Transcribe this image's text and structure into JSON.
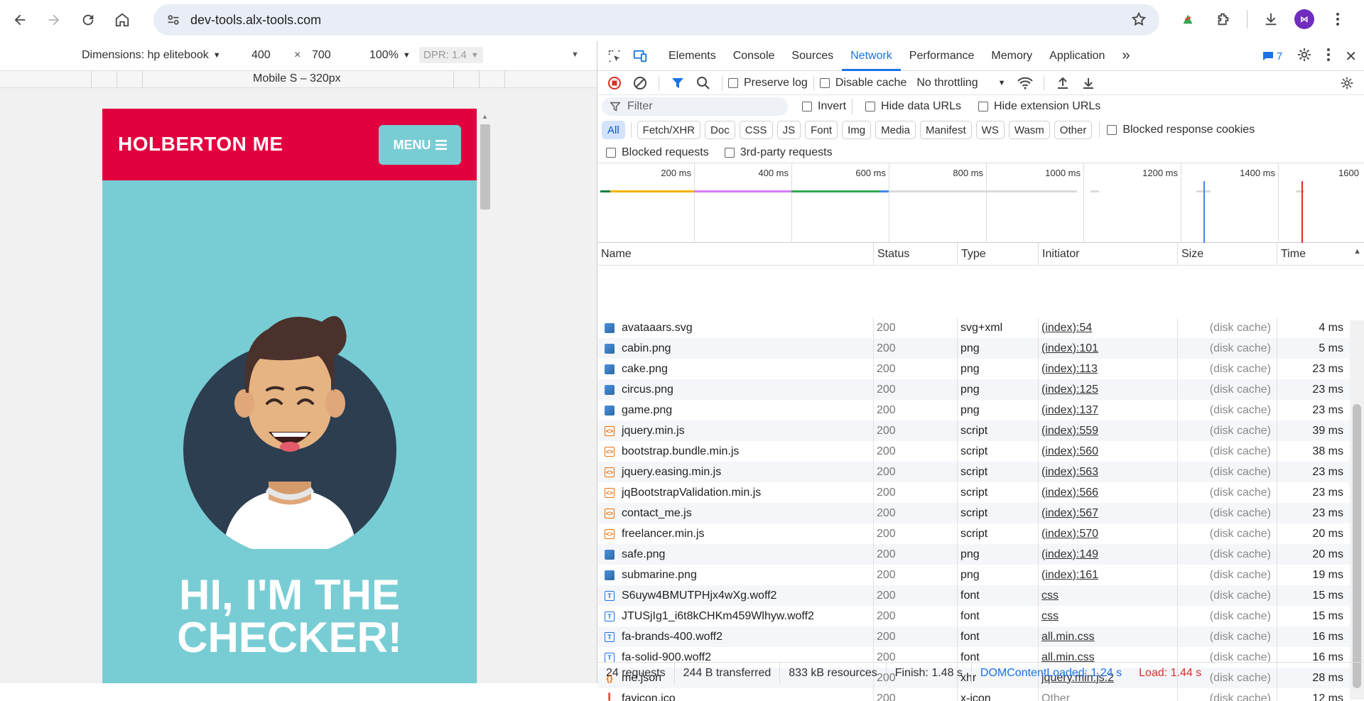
{
  "browser": {
    "url": "dev-tools.alx-tools.com",
    "back_icon": "arrow-left",
    "forward_icon": "arrow-right",
    "reload_icon": "reload",
    "home_icon": "home"
  },
  "device_toolbar": {
    "dimensions_label": "Dimensions: hp elitebook",
    "width": "400",
    "times": "×",
    "height": "700",
    "zoom": "100%",
    "dpr": "DPR: 1.4",
    "media_query_label": "Mobile S – 320px"
  },
  "site": {
    "brand": "HOLBERTON ME",
    "menu_label": "MENU",
    "hero_line1": "HI, I'M THE",
    "hero_line2": "CHECKER!"
  },
  "devtools": {
    "tabs": [
      "Elements",
      "Console",
      "Sources",
      "Network",
      "Performance",
      "Memory",
      "Application"
    ],
    "active_tab": "Network",
    "issues_count": "7",
    "toolbar": {
      "preserve_log": "Preserve log",
      "disable_cache": "Disable cache",
      "throttling": "No throttling"
    },
    "filter": {
      "placeholder": "Filter",
      "invert": "Invert",
      "hide_data_urls": "Hide data URLs",
      "hide_extension_urls": "Hide extension URLs"
    },
    "type_filters": [
      "All",
      "Fetch/XHR",
      "Doc",
      "CSS",
      "JS",
      "Font",
      "Img",
      "Media",
      "Manifest",
      "WS",
      "Wasm",
      "Other"
    ],
    "blocked_response_cookies": "Blocked response cookies",
    "blocked_requests": "Blocked requests",
    "third_party_requests": "3rd-party requests",
    "overview_ticks": [
      "200 ms",
      "400 ms",
      "600 ms",
      "800 ms",
      "1000 ms",
      "1200 ms",
      "1400 ms",
      "1600"
    ],
    "columns": [
      "Name",
      "Status",
      "Type",
      "Initiator",
      "Size",
      "Time"
    ],
    "requests": [
      {
        "icon": "img",
        "name": "avataaars.svg",
        "status": "200",
        "type": "svg+xml",
        "initiator": "(index):54",
        "size": "(disk cache)",
        "time": "4 ms"
      },
      {
        "icon": "img",
        "name": "cabin.png",
        "status": "200",
        "type": "png",
        "initiator": "(index):101",
        "size": "(disk cache)",
        "time": "5 ms"
      },
      {
        "icon": "img",
        "name": "cake.png",
        "status": "200",
        "type": "png",
        "initiator": "(index):113",
        "size": "(disk cache)",
        "time": "23 ms"
      },
      {
        "icon": "img",
        "name": "circus.png",
        "status": "200",
        "type": "png",
        "initiator": "(index):125",
        "size": "(disk cache)",
        "time": "23 ms"
      },
      {
        "icon": "img",
        "name": "game.png",
        "status": "200",
        "type": "png",
        "initiator": "(index):137",
        "size": "(disk cache)",
        "time": "23 ms"
      },
      {
        "icon": "script",
        "name": "jquery.min.js",
        "status": "200",
        "type": "script",
        "initiator": "(index):559",
        "size": "(disk cache)",
        "time": "39 ms"
      },
      {
        "icon": "script",
        "name": "bootstrap.bundle.min.js",
        "status": "200",
        "type": "script",
        "initiator": "(index):560",
        "size": "(disk cache)",
        "time": "38 ms"
      },
      {
        "icon": "script",
        "name": "jquery.easing.min.js",
        "status": "200",
        "type": "script",
        "initiator": "(index):563",
        "size": "(disk cache)",
        "time": "23 ms"
      },
      {
        "icon": "script",
        "name": "jqBootstrapValidation.min.js",
        "status": "200",
        "type": "script",
        "initiator": "(index):566",
        "size": "(disk cache)",
        "time": "23 ms"
      },
      {
        "icon": "script",
        "name": "contact_me.js",
        "status": "200",
        "type": "script",
        "initiator": "(index):567",
        "size": "(disk cache)",
        "time": "23 ms"
      },
      {
        "icon": "script",
        "name": "freelancer.min.js",
        "status": "200",
        "type": "script",
        "initiator": "(index):570",
        "size": "(disk cache)",
        "time": "20 ms"
      },
      {
        "icon": "img",
        "name": "safe.png",
        "status": "200",
        "type": "png",
        "initiator": "(index):149",
        "size": "(disk cache)",
        "time": "20 ms"
      },
      {
        "icon": "img",
        "name": "submarine.png",
        "status": "200",
        "type": "png",
        "initiator": "(index):161",
        "size": "(disk cache)",
        "time": "19 ms"
      },
      {
        "icon": "font",
        "name": "S6uyw4BMUTPHjx4wXg.woff2",
        "status": "200",
        "type": "font",
        "initiator": "css",
        "size": "(disk cache)",
        "time": "15 ms"
      },
      {
        "icon": "font",
        "name": "JTUSjIg1_i6t8kCHKm459Wlhyw.woff2",
        "status": "200",
        "type": "font",
        "initiator": "css",
        "size": "(disk cache)",
        "time": "15 ms"
      },
      {
        "icon": "font",
        "name": "fa-brands-400.woff2",
        "status": "200",
        "type": "font",
        "initiator": "all.min.css",
        "size": "(disk cache)",
        "time": "16 ms"
      },
      {
        "icon": "font",
        "name": "fa-solid-900.woff2",
        "status": "200",
        "type": "font",
        "initiator": "all.min.css",
        "size": "(disk cache)",
        "time": "16 ms"
      },
      {
        "icon": "xhr",
        "name": "me.json",
        "status": "200",
        "type": "xhr",
        "initiator": "jquery.min.js:2",
        "size": "(disk cache)",
        "time": "28 ms"
      },
      {
        "icon": "ico",
        "name": "favicon.ico",
        "status": "200",
        "type": "x-icon",
        "initiator": "Other",
        "initiator_plain": true,
        "size": "(disk cache)",
        "time": "12 ms"
      }
    ],
    "summary": {
      "requests": "24 requests",
      "transferred": "244 B transferred",
      "resources": "833 kB resources",
      "finish": "Finish: 1.48 s",
      "dom_content_loaded": "DOMContentLoaded: 1.24 s",
      "load": "Load: 1.44 s"
    }
  }
}
